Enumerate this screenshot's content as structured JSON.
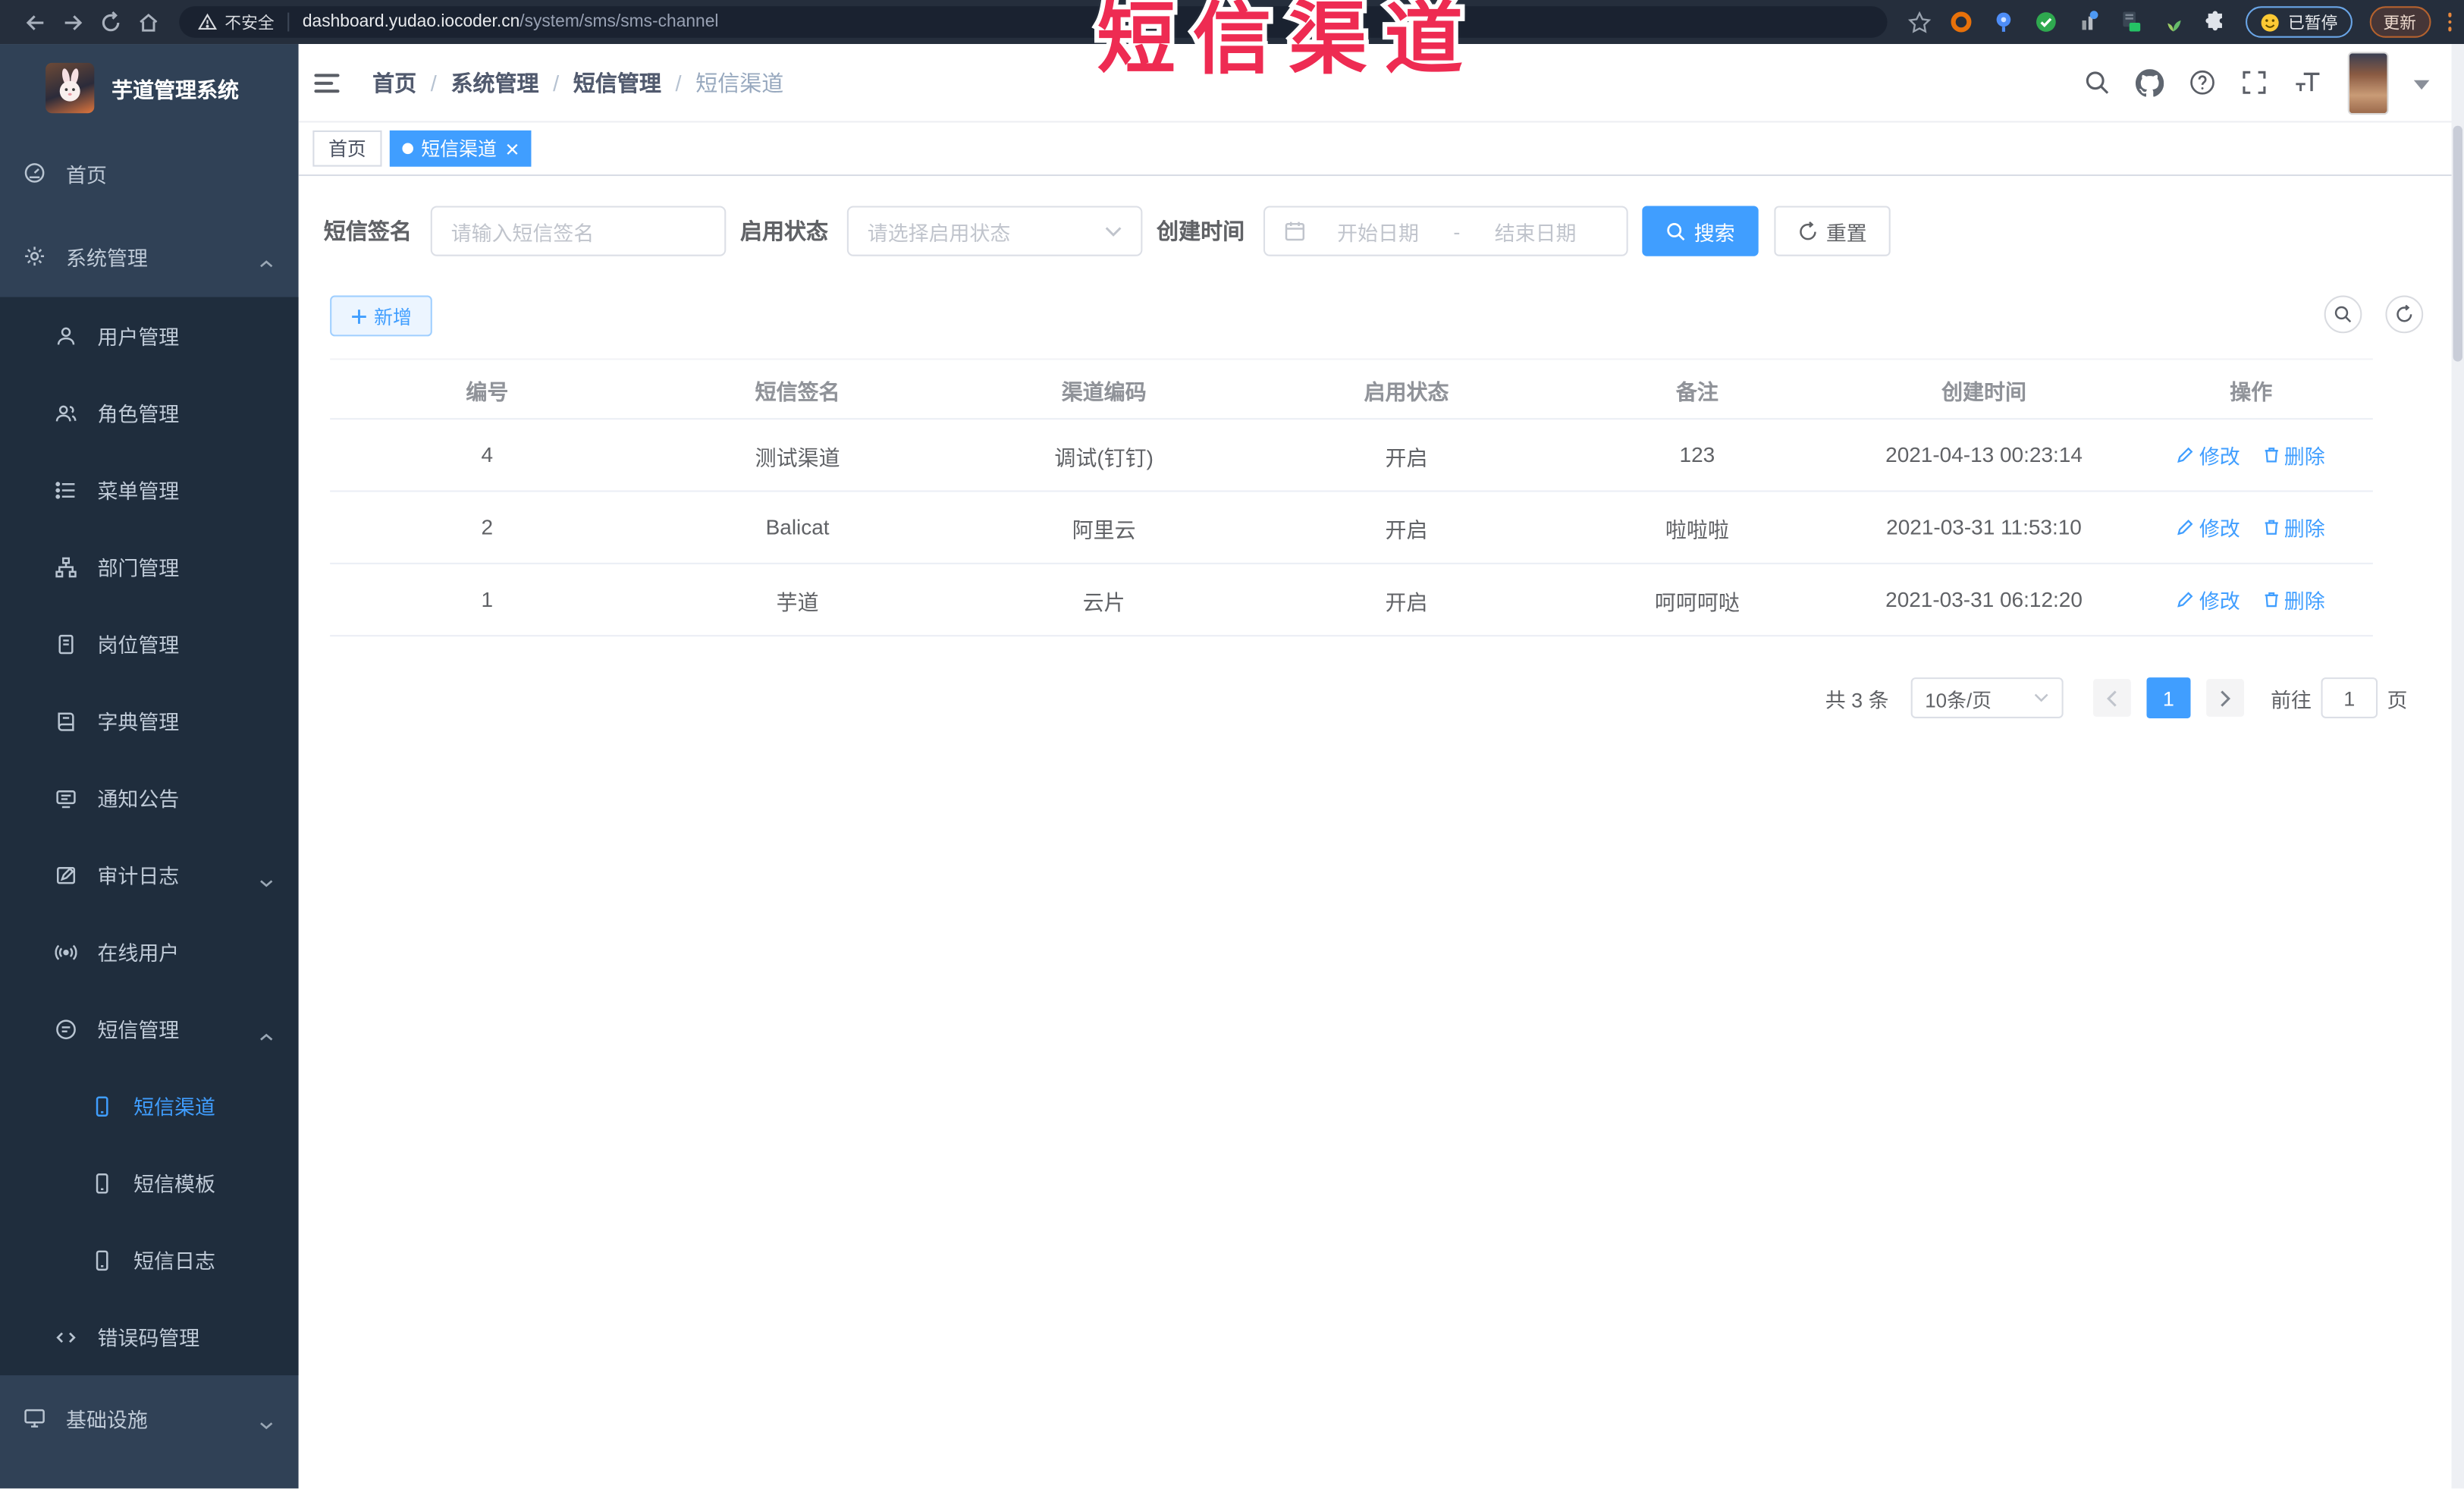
{
  "browser": {
    "security_label": "不安全",
    "url_domain": "dashboard.yudao.iocoder.cn",
    "url_path": "/system/sms/sms-channel",
    "paused_badge": "已暂停",
    "update_button": "更新"
  },
  "watermark": {
    "text": "短信渠道",
    "color": "#ee2b52"
  },
  "sidebar": {
    "logo_title": "芋道管理系统",
    "items": [
      {
        "label": "首页",
        "icon": "dashboard-icon",
        "level": 1
      },
      {
        "label": "系统管理",
        "icon": "gear-icon",
        "level": 1,
        "state": "expanded"
      },
      {
        "label": "用户管理",
        "icon": "user-icon",
        "level": 2
      },
      {
        "label": "角色管理",
        "icon": "users-icon",
        "level": 2
      },
      {
        "label": "菜单管理",
        "icon": "menu-list-icon",
        "level": 2
      },
      {
        "label": "部门管理",
        "icon": "org-tree-icon",
        "level": 2
      },
      {
        "label": "岗位管理",
        "icon": "id-badge-icon",
        "level": 2
      },
      {
        "label": "字典管理",
        "icon": "dictionary-icon",
        "level": 2
      },
      {
        "label": "通知公告",
        "icon": "announcement-icon",
        "level": 2
      },
      {
        "label": "审计日志",
        "icon": "audit-log-icon",
        "level": 2,
        "state": "collapsed"
      },
      {
        "label": "在线用户",
        "icon": "online-users-icon",
        "level": 2
      },
      {
        "label": "短信管理",
        "icon": "sms-icon",
        "level": 2,
        "state": "expanded"
      },
      {
        "label": "短信渠道",
        "icon": "phone-icon",
        "level": 3,
        "active": true
      },
      {
        "label": "短信模板",
        "icon": "phone-icon",
        "level": 3
      },
      {
        "label": "短信日志",
        "icon": "phone-icon",
        "level": 3
      },
      {
        "label": "错误码管理",
        "icon": "code-icon",
        "level": 2
      },
      {
        "label": "基础设施",
        "icon": "monitor-icon",
        "level": 1,
        "state": "collapsed"
      }
    ]
  },
  "header": {
    "breadcrumb": [
      "首页",
      "系统管理",
      "短信管理",
      "短信渠道"
    ],
    "separator": "/"
  },
  "tabs": [
    {
      "label": "首页",
      "active": false
    },
    {
      "label": "短信渠道",
      "active": true,
      "closable": true
    }
  ],
  "filters": {
    "signature_label": "短信签名",
    "signature_placeholder": "请输入短信签名",
    "status_label": "启用状态",
    "status_placeholder": "请选择启用状态",
    "time_label": "创建时间",
    "start_placeholder": "开始日期",
    "range_separator": "-",
    "end_placeholder": "结束日期",
    "search_button": "搜索",
    "reset_button": "重置"
  },
  "toolbar": {
    "add_button": "新增"
  },
  "table": {
    "columns": [
      "编号",
      "短信签名",
      "渠道编码",
      "启用状态",
      "备注",
      "创建时间",
      "操作"
    ],
    "rows": [
      {
        "id": "4",
        "signature": "测试渠道",
        "code": "调试(钉钉)",
        "status": "开启",
        "remark": "123",
        "created": "2021-04-13 00:23:14",
        "edit": "修改",
        "delete": "删除"
      },
      {
        "id": "2",
        "signature": "Balicat",
        "code": "阿里云",
        "status": "开启",
        "remark": "啦啦啦",
        "created": "2021-03-31 11:53:10",
        "edit": "修改",
        "delete": "删除"
      },
      {
        "id": "1",
        "signature": "芋道",
        "code": "云片",
        "status": "开启",
        "remark": "呵呵呵哒",
        "created": "2021-03-31 06:12:20",
        "edit": "修改",
        "delete": "删除"
      }
    ]
  },
  "pagination": {
    "total": "共 3 条",
    "page_size": "10条/页",
    "current_page": "1",
    "goto_label": "前往",
    "goto_value": "1",
    "page_unit": "页"
  },
  "colors": {
    "accent": "#409eff",
    "sidebar_bg": "#304156",
    "submenu_bg": "#1f2d3d",
    "chrome_bg": "#252e3c",
    "watermark": "#ee2b52"
  }
}
